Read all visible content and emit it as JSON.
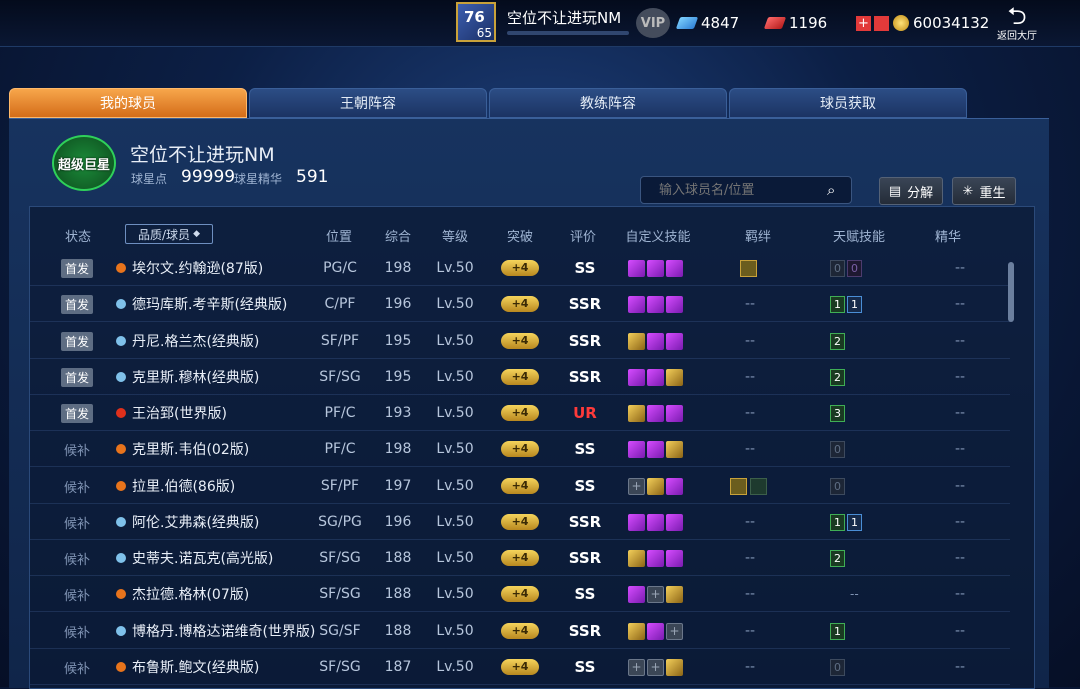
{
  "topbar": {
    "level": "65",
    "player_name": "空位不让进玩NM",
    "vip_label": "VIP",
    "diamond": "4847",
    "ticket": "1196",
    "coins": "60034132",
    "return_label": "返回大厅"
  },
  "tabs": [
    {
      "label": "我的球员",
      "active": true
    },
    {
      "label": "王朝阵容",
      "active": false
    },
    {
      "label": "教练阵容",
      "active": false
    },
    {
      "label": "球员获取",
      "active": false
    }
  ],
  "team": {
    "badge_text": "超级巨星",
    "name": "空位不让进玩NM",
    "star_points_label": "球星点",
    "star_points": "99999",
    "essence_label": "球星精华",
    "essence": "591"
  },
  "search": {
    "placeholder": "输入球员名/位置"
  },
  "buttons": {
    "decompose": "分解",
    "rebirth": "重生"
  },
  "table": {
    "headers": {
      "status": "状态",
      "quality": "品质/球员",
      "position": "位置",
      "overall": "综合",
      "level": "等级",
      "breakthrough": "突破",
      "rating": "评价",
      "custom_skills": "自定义技能",
      "bond": "羁绊",
      "talent": "天赋技能",
      "essence": "精华"
    },
    "rows": [
      {
        "status": "首发",
        "name": "埃尔文.约翰逊(87版)",
        "pos": "PG/C",
        "ovr": "198",
        "lvl": "Lv.50",
        "brk": "+4",
        "rating": "SS",
        "dot": "#e8741c",
        "skills": [
          "p",
          "p",
          "p"
        ],
        "bond": "icon",
        "talent": [
          [
            "0",
            "gray"
          ],
          [
            "0",
            "purp"
          ]
        ],
        "essence": "--"
      },
      {
        "status": "首发",
        "name": "德玛库斯.考辛斯(经典版)",
        "pos": "C/PF",
        "ovr": "196",
        "lvl": "Lv.50",
        "brk": "+4",
        "rating": "SSR",
        "dot": "#7fc1ea",
        "skills": [
          "p",
          "p",
          "p"
        ],
        "bond": "--",
        "talent": [
          [
            "1",
            "green"
          ],
          [
            "1",
            "blue"
          ]
        ],
        "essence": "--"
      },
      {
        "status": "首发",
        "name": "丹尼.格兰杰(经典版)",
        "pos": "SF/PF",
        "ovr": "195",
        "lvl": "Lv.50",
        "brk": "+4",
        "rating": "SSR",
        "dot": "#7fc1ea",
        "skills": [
          "g",
          "p",
          "p"
        ],
        "bond": "--",
        "talent": [
          [
            "2",
            "green"
          ]
        ],
        "essence": "--"
      },
      {
        "status": "首发",
        "name": "克里斯.穆林(经典版)",
        "pos": "SF/SG",
        "ovr": "195",
        "lvl": "Lv.50",
        "brk": "+4",
        "rating": "SSR",
        "dot": "#7fc1ea",
        "skills": [
          "p",
          "p",
          "g"
        ],
        "bond": "--",
        "talent": [
          [
            "2",
            "green"
          ]
        ],
        "essence": "--"
      },
      {
        "status": "首发",
        "name": "王治郅(世界版)",
        "pos": "PF/C",
        "ovr": "193",
        "lvl": "Lv.50",
        "brk": "+4",
        "rating": "UR",
        "dot": "#e0301c",
        "skills": [
          "g",
          "p",
          "p"
        ],
        "bond": "--",
        "talent": [
          [
            "3",
            "green"
          ]
        ],
        "essence": "--"
      },
      {
        "status": "候补",
        "name": "克里斯.韦伯(02版)",
        "pos": "PF/C",
        "ovr": "198",
        "lvl": "Lv.50",
        "brk": "+4",
        "rating": "SS",
        "dot": "#e8741c",
        "skills": [
          "p",
          "p",
          "g"
        ],
        "bond": "--",
        "talent": [
          [
            "0",
            "gray"
          ]
        ],
        "essence": "--"
      },
      {
        "status": "候补",
        "name": "拉里.伯德(86版)",
        "pos": "SF/PF",
        "ovr": "197",
        "lvl": "Lv.50",
        "brk": "+4",
        "rating": "SS",
        "dot": "#e8741c",
        "skills": [
          "e",
          "g",
          "p"
        ],
        "bond": "icon2",
        "talent": [
          [
            "0",
            "gray"
          ]
        ],
        "essence": "--"
      },
      {
        "status": "候补",
        "name": "阿伦.艾弗森(经典版)",
        "pos": "SG/PG",
        "ovr": "196",
        "lvl": "Lv.50",
        "brk": "+4",
        "rating": "SSR",
        "dot": "#7fc1ea",
        "skills": [
          "p",
          "p",
          "p"
        ],
        "bond": "--",
        "talent": [
          [
            "1",
            "green"
          ],
          [
            "1",
            "blue"
          ]
        ],
        "essence": "--"
      },
      {
        "status": "候补",
        "name": "史蒂夫.诺瓦克(高光版)",
        "pos": "SF/SG",
        "ovr": "188",
        "lvl": "Lv.50",
        "brk": "+4",
        "rating": "SSR",
        "dot": "#7fc1ea",
        "skills": [
          "g",
          "p",
          "p"
        ],
        "bond": "--",
        "talent": [
          [
            "2",
            "green"
          ]
        ],
        "essence": "--"
      },
      {
        "status": "候补",
        "name": "杰拉德.格林(07版)",
        "pos": "SF/SG",
        "ovr": "188",
        "lvl": "Lv.50",
        "brk": "+4",
        "rating": "SS",
        "dot": "#e8741c",
        "skills": [
          "p",
          "e",
          "g"
        ],
        "bond": "--",
        "talent": [
          [
            "--",
            "none"
          ]
        ],
        "essence": "--"
      },
      {
        "status": "候补",
        "name": "博格丹.博格达诺维奇(世界版)",
        "pos": "SG/SF",
        "ovr": "188",
        "lvl": "Lv.50",
        "brk": "+4",
        "rating": "SSR",
        "dot": "#7fc1ea",
        "skills": [
          "g",
          "p",
          "e"
        ],
        "bond": "--",
        "talent": [
          [
            "1",
            "green"
          ]
        ],
        "essence": "--"
      },
      {
        "status": "候补",
        "name": "布鲁斯.鲍文(经典版)",
        "pos": "SF/SG",
        "ovr": "187",
        "lvl": "Lv.50",
        "brk": "+4",
        "rating": "SS",
        "dot": "#e8741c",
        "skills": [
          "e",
          "e",
          "g"
        ],
        "bond": "--",
        "talent": [
          [
            "0",
            "gray"
          ]
        ],
        "essence": "--"
      }
    ]
  }
}
